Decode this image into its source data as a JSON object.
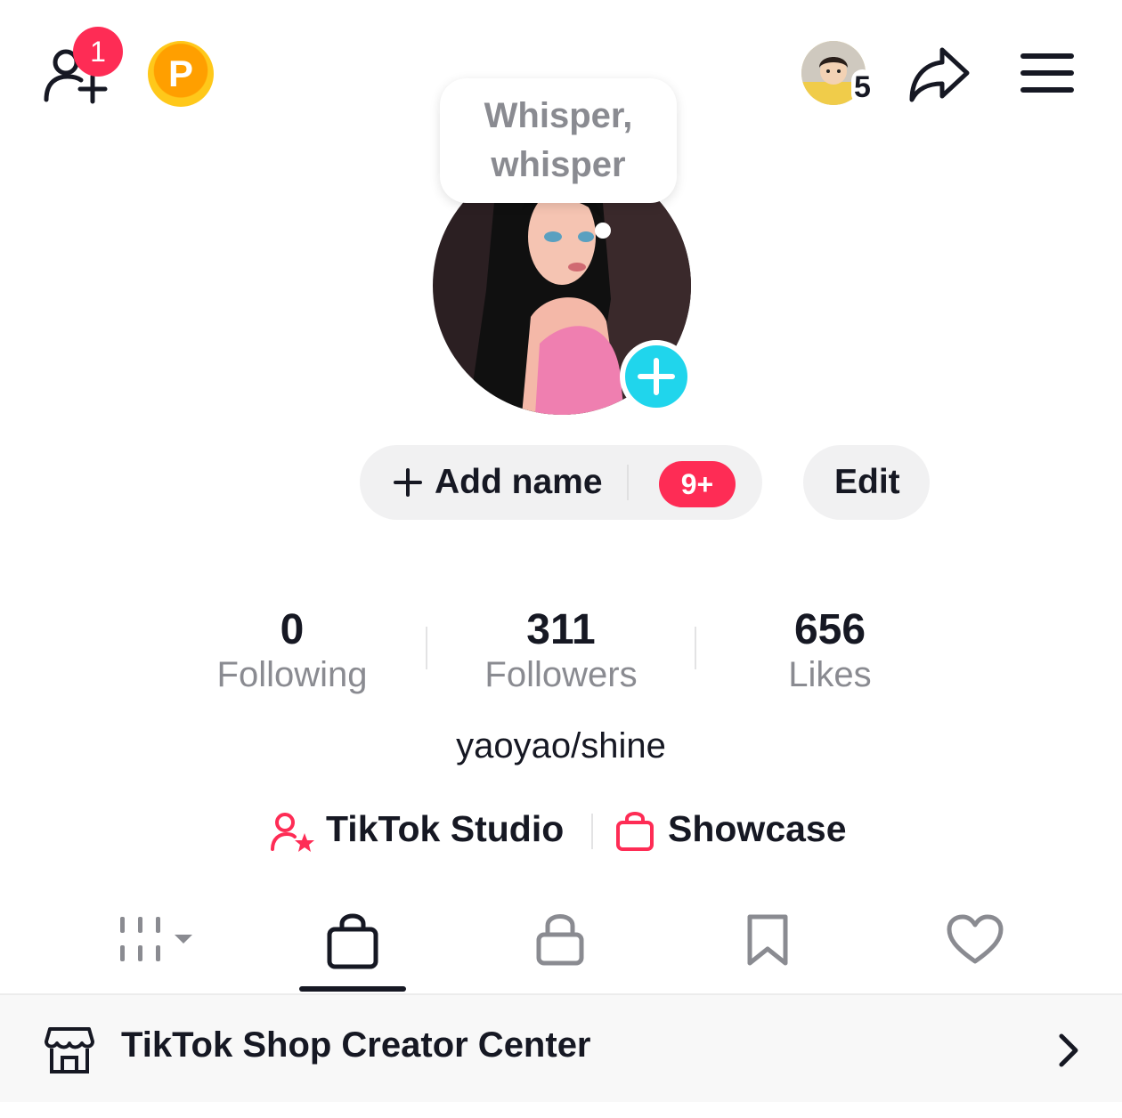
{
  "header": {
    "friend_request_count": "1",
    "coin_label": "P",
    "account_switch_count": "5"
  },
  "profile": {
    "note_text": "Whisper, whisper",
    "add_name_label": "Add name",
    "add_name_badge": "9+",
    "edit_label": "Edit",
    "bio": "yaoyao/shine"
  },
  "stats": [
    {
      "value": "0",
      "label": "Following"
    },
    {
      "value": "311",
      "label": "Followers"
    },
    {
      "value": "656",
      "label": "Likes"
    }
  ],
  "links": {
    "studio_label": "TikTok Studio",
    "showcase_label": "Showcase"
  },
  "tabs": [
    {
      "icon": "grid-icon",
      "selected": false
    },
    {
      "icon": "shopping-bag-icon",
      "selected": true
    },
    {
      "icon": "lock-icon",
      "selected": false
    },
    {
      "icon": "bookmark-icon",
      "selected": false
    },
    {
      "icon": "heart-icon",
      "selected": false
    }
  ],
  "shop_banner": {
    "label": "TikTok Shop Creator Center"
  },
  "colors": {
    "accent_red": "#fe2c55",
    "accent_cyan": "#20d5ec",
    "coin_orange": "#ff9f00",
    "text_primary": "#161823",
    "text_secondary": "#8a8b91"
  }
}
